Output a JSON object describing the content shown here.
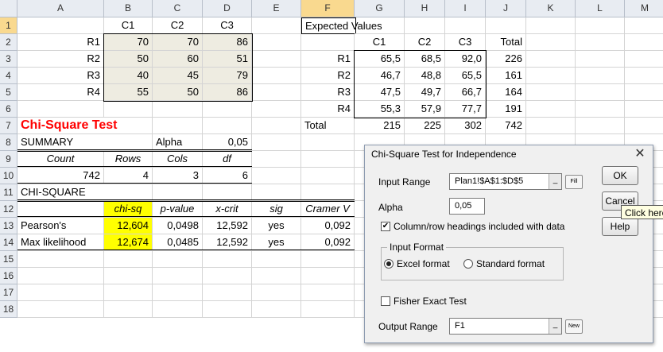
{
  "columns": [
    "A",
    "B",
    "C",
    "D",
    "E",
    "F",
    "G",
    "H",
    "I",
    "J",
    "K",
    "L",
    "M"
  ],
  "rows": [
    "1",
    "2",
    "3",
    "4",
    "5",
    "6",
    "7",
    "8",
    "9",
    "10",
    "11",
    "12",
    "13",
    "14",
    "15",
    "16",
    "17",
    "18"
  ],
  "colors": {
    "tan_fill": "#eeece1",
    "yellow_fill": "#ffff00",
    "red_title": "#ff0000",
    "header_bg": "#e8ecf2",
    "selected_header": "#f9d98f"
  },
  "sheet": {
    "r1": {
      "B": "C1",
      "C": "C2",
      "D": "C3",
      "F": "Expected Values"
    },
    "r2": {
      "A": "R1",
      "B": "70",
      "C": "70",
      "D": "86",
      "G": "C1",
      "H": "C2",
      "I": "C3",
      "J": "Total"
    },
    "r3": {
      "A": "R2",
      "B": "50",
      "C": "60",
      "D": "51",
      "F": "R1",
      "G": "65,5",
      "H": "68,5",
      "I": "92,0",
      "J": "226"
    },
    "r4": {
      "A": "R3",
      "B": "40",
      "C": "45",
      "D": "79",
      "F": "R2",
      "G": "46,7",
      "H": "48,8",
      "I": "65,5",
      "J": "161"
    },
    "r5": {
      "A": "R4",
      "B": "55",
      "C": "50",
      "D": "86",
      "F": "R3",
      "G": "47,5",
      "H": "49,7",
      "I": "66,7",
      "J": "164"
    },
    "r6": {
      "F": "R4",
      "G": "55,3",
      "H": "57,9",
      "I": "77,7",
      "J": "191"
    },
    "r7": {
      "A": "Chi-Square Test",
      "F": "Total",
      "G": "215",
      "H": "225",
      "I": "302",
      "J": "742"
    },
    "r8": {
      "A": "SUMMARY",
      "C": "Alpha",
      "D": "0,05"
    },
    "r9": {
      "A": "Count",
      "B": "Rows",
      "C": "Cols",
      "D": "df"
    },
    "r10": {
      "A": "742",
      "B": "4",
      "C": "3",
      "D": "6"
    },
    "r11": {
      "A": "CHI-SQUARE"
    },
    "r12": {
      "B": "chi-sq",
      "C": "p-value",
      "D": "x-crit",
      "E": "sig",
      "F": "Cramer V"
    },
    "r13": {
      "A": "Pearson's",
      "B": "12,604",
      "C": "0,0498",
      "D": "12,592",
      "E": "yes",
      "F": "0,092"
    },
    "r14": {
      "A": "Max likelihood",
      "B": "12,674",
      "C": "0,0485",
      "D": "12,592",
      "E": "yes",
      "F": "0,092"
    }
  },
  "dialog": {
    "title": "Chi-Square Test for Independence",
    "close_icon": "close-icon",
    "input_range_label": "Input Range",
    "input_range_value": "Plan1!$A$1:$D$5",
    "fill_label": "Fill",
    "alpha_label": "Alpha",
    "alpha_value": "0,05",
    "headings_label": "Column/row headings included with data",
    "headings_checked": true,
    "format_group_label": "Input Format",
    "excel_format_label": "Excel format",
    "standard_format_label": "Standard format",
    "excel_format_selected": true,
    "fisher_label": "Fisher Exact Test",
    "fisher_checked": false,
    "output_range_label": "Output Range",
    "output_range_value": "F1",
    "new_label": "New",
    "ok_label": "OK",
    "cancel_label": "Cancel",
    "help_label": "Help",
    "tooltip": "Click here"
  }
}
